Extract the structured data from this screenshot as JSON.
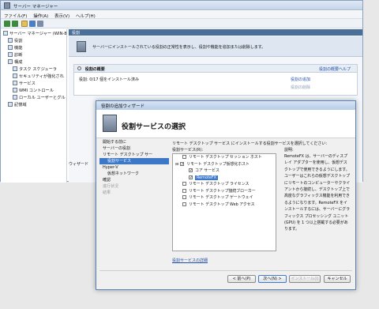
{
  "server_manager": {
    "title": "サーバー マネージャー",
    "menu": [
      "ファイル(F)",
      "操作(A)",
      "表示(V)",
      "ヘルプ(H)"
    ],
    "tree": [
      {
        "label": "サーバー マネージャー (WIN-8",
        "indent": 0
      },
      {
        "label": "役割",
        "indent": 1
      },
      {
        "label": "機能",
        "indent": 1
      },
      {
        "label": "診断",
        "indent": 1
      },
      {
        "label": "構成",
        "indent": 1
      },
      {
        "label": "タスク スケジューラ",
        "indent": 2
      },
      {
        "label": "セキュリティが強化され",
        "indent": 2
      },
      {
        "label": "サービス",
        "indent": 2
      },
      {
        "label": "WMI コントロール",
        "indent": 2
      },
      {
        "label": "ローカル ユーザーとグル",
        "indent": 2
      },
      {
        "label": "記憶域",
        "indent": 1
      }
    ],
    "panel_header": "役割",
    "banner_text": "サーバーにインストールされている役割の正常性を表示し、役割や機能を追加または削除します。",
    "summary_title": "役割の概要",
    "summary_help": "役割の概要ヘルプ",
    "roles_count": "役割: 0/17 個をインストール済み",
    "add_roles": "役割の追加",
    "remove_roles": "役割の削除",
    "status_text": "ウィザード"
  },
  "wizard": {
    "title": "役割の追加ウィザード",
    "heading": "役割サービスの選択",
    "nav": [
      {
        "label": "開始する前に",
        "state": "normal",
        "sub": false
      },
      {
        "label": "サーバーの役割",
        "state": "normal",
        "sub": false
      },
      {
        "label": "リモート デスクトップ サー",
        "state": "normal",
        "sub": false
      },
      {
        "label": "役割サービス",
        "state": "selected",
        "sub": true
      },
      {
        "label": "Hyper-V",
        "state": "normal",
        "sub": false
      },
      {
        "label": "仮想ネットワーク",
        "state": "normal",
        "sub": true
      },
      {
        "label": "確認",
        "state": "normal",
        "sub": false
      },
      {
        "label": "進行状況",
        "state": "disabled",
        "sub": false
      },
      {
        "label": "結果",
        "state": "disabled",
        "sub": false
      }
    ],
    "intro": "リモート デスクトップ サービス にインストールする役割サービスを選択してください:",
    "list_label": "役割サービス(R):",
    "services": [
      {
        "label": "リモート デスクトップ セッション ホスト",
        "checked": false,
        "level": 1,
        "highlight": false
      },
      {
        "label": "リモート デスクトップ仮想化ホスト",
        "checked": true,
        "level": 0,
        "highlight": false
      },
      {
        "label": "コア サービス",
        "checked": true,
        "level": 2,
        "highlight": false
      },
      {
        "label": "RemoteFX",
        "checked": true,
        "level": 2,
        "highlight": true
      },
      {
        "label": "リモート デスクトップ ライセンス",
        "checked": false,
        "level": 1,
        "highlight": false
      },
      {
        "label": "リモート デスクトップ接続ブローカー",
        "checked": false,
        "level": 1,
        "highlight": false
      },
      {
        "label": "リモート デスクトップ ゲートウェイ",
        "checked": false,
        "level": 1,
        "highlight": false
      },
      {
        "label": "リモート デスクトップ Web アクセス",
        "checked": false,
        "level": 1,
        "highlight": false
      }
    ],
    "desc_label": "説明:",
    "description": "RemoteFX は、サーバーのディスプレイ アダプターを使用し、仮想デスクトップで使用できるようにします。ユーザーはこれらの仮想デスクトップにリモートのコンピューターやクライアントから接続し、デスクトップ上で高度なグラフィックス機能を利用できるようになります。RemoteFX をインストールするには、サーバーにグラフィックス プロセッシング ユニット (GPU) を 1 つ以上搭載する必要があります。",
    "more_info": "役割サービスの詳細",
    "buttons": {
      "back": "< 前へ(P)",
      "next": "次へ(N) >",
      "install": "インストール(I)",
      "cancel": "キャンセル"
    }
  },
  "colors": {
    "accent": "#3d78c8",
    "header": "#4a6f98"
  }
}
